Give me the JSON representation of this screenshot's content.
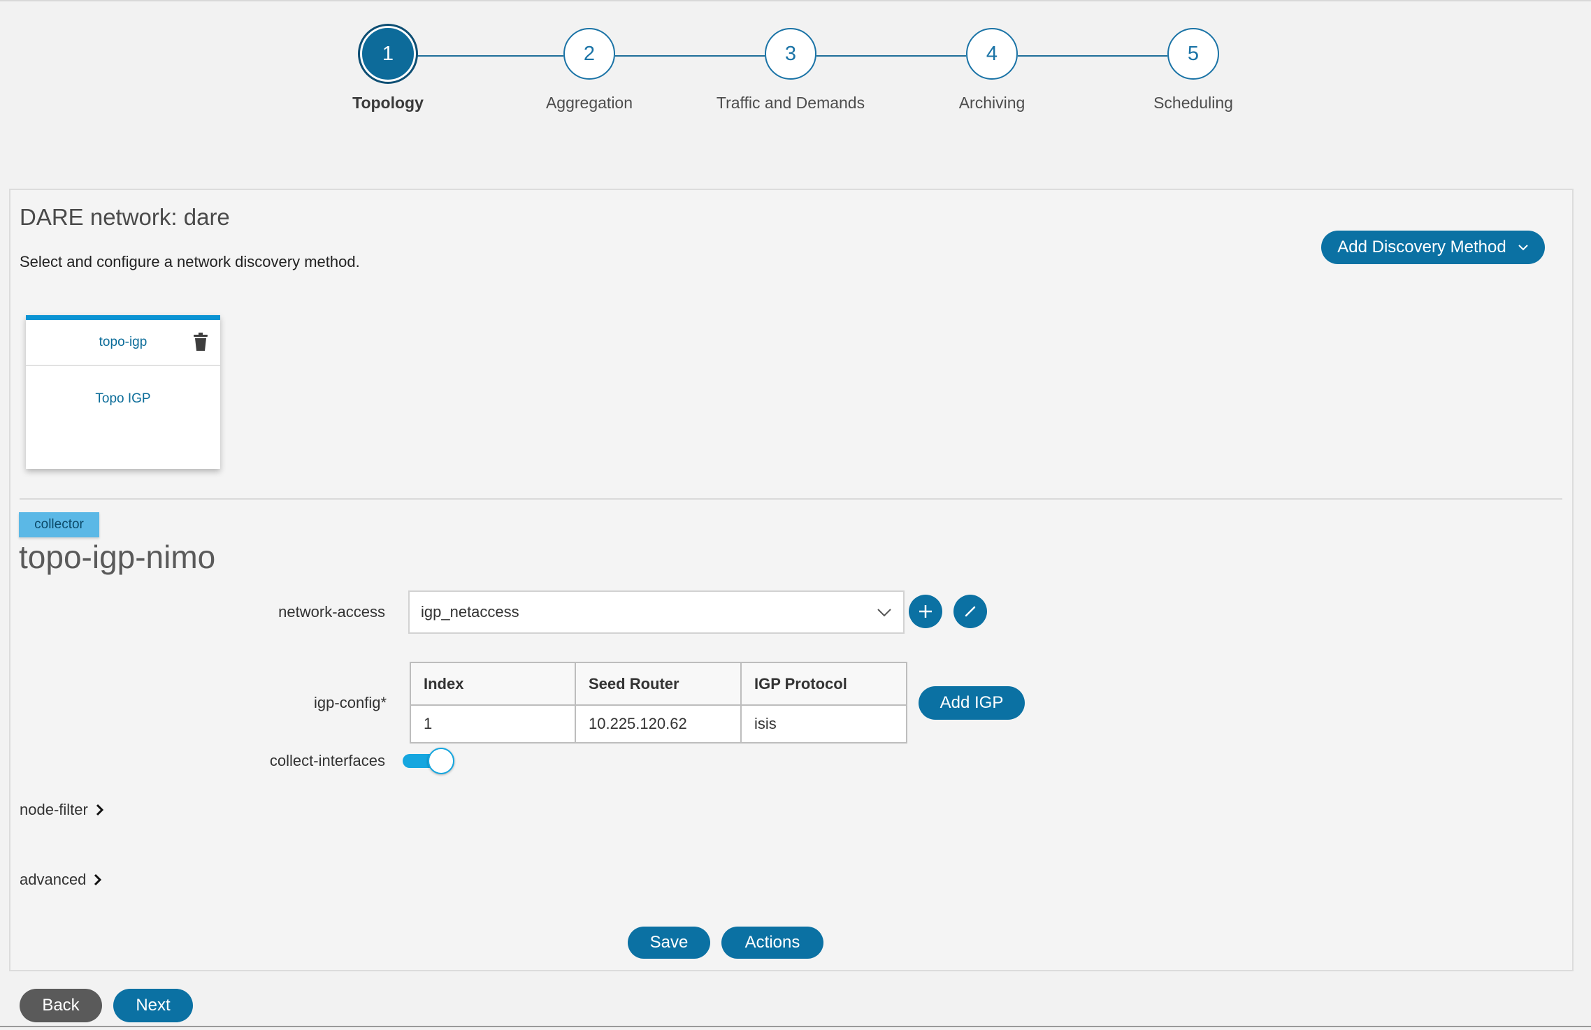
{
  "stepper": {
    "steps": [
      {
        "number": "1",
        "label": "Topology",
        "active": true
      },
      {
        "number": "2",
        "label": "Aggregation",
        "active": false
      },
      {
        "number": "3",
        "label": "Traffic and Demands",
        "active": false
      },
      {
        "number": "4",
        "label": "Archiving",
        "active": false
      },
      {
        "number": "5",
        "label": "Scheduling",
        "active": false
      }
    ]
  },
  "header": {
    "network_title": "DARE network: dare",
    "subtitle": "Select and configure a network discovery method.",
    "add_discovery_label": "Add Discovery Method"
  },
  "discovery_card": {
    "title": "topo-igp",
    "description": "Topo IGP",
    "accent_color": "#0a93d3"
  },
  "collector": {
    "badge": "collector",
    "name": "topo-igp-nimo"
  },
  "form": {
    "network_access_label": "network-access",
    "network_access_value": "igp_netaccess",
    "igp_config_label": "igp-config*",
    "collect_interfaces_label": "collect-interfaces",
    "collect_interfaces_on": true,
    "add_igp_label": "Add IGP",
    "igp_table": {
      "headers": [
        "Index",
        "Seed Router",
        "IGP Protocol"
      ],
      "rows": [
        [
          "1",
          "10.225.120.62",
          "isis"
        ]
      ]
    },
    "node_filter_label": "node-filter",
    "advanced_label": "advanced"
  },
  "footer": {
    "save_label": "Save",
    "actions_label": "Actions",
    "back_label": "Back",
    "next_label": "Next"
  },
  "colors": {
    "primary": "#0b71a3",
    "toggle": "#15a6df",
    "badge": "#5bb8e6",
    "back": "#5a5a5a"
  }
}
